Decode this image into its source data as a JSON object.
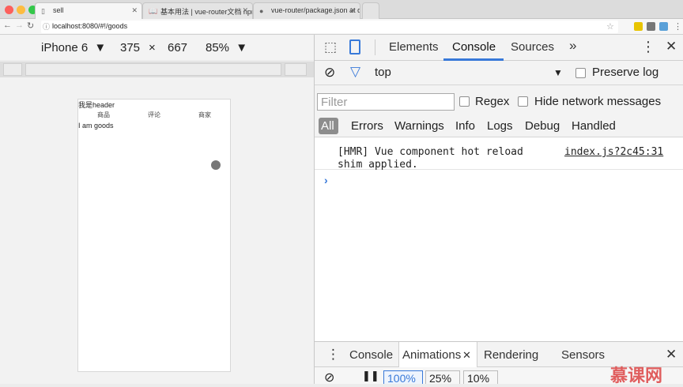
{
  "browser": {
    "tabs": [
      {
        "title": "sell",
        "icon": "page-icon"
      },
      {
        "title": "基本用法 | vue-router文档 npm",
        "icon": "book-icon"
      },
      {
        "title": "vue-router/package.json at de",
        "icon": "github-icon"
      }
    ],
    "url": "localhost:8080/#!/goods"
  },
  "device_toolbar": {
    "device": "iPhone 6",
    "width": "375",
    "times": "×",
    "height": "667",
    "zoom": "85%"
  },
  "app": {
    "header": "我是header",
    "nav": [
      "商品",
      "评论",
      "商家"
    ],
    "content": "I am goods"
  },
  "devtools": {
    "tabs": [
      "Elements",
      "Console",
      "Sources",
      "»"
    ],
    "context": "top",
    "preserve_log": "Preserve log",
    "filter_placeholder": "Filter",
    "regex": "Regex",
    "hide_network": "Hide network messages",
    "levels": [
      "All",
      "Errors",
      "Warnings",
      "Info",
      "Logs",
      "Debug",
      "Handled"
    ],
    "message_line1": "[HMR] Vue component hot reload",
    "message_line2": "shim applied.",
    "message_source": "index.js?2c45:31",
    "drawer_tabs": [
      "Console",
      "Animations",
      "Rendering",
      "Sensors"
    ],
    "speeds": [
      "100%",
      "25%",
      "10%"
    ]
  },
  "watermark": "慕课网"
}
